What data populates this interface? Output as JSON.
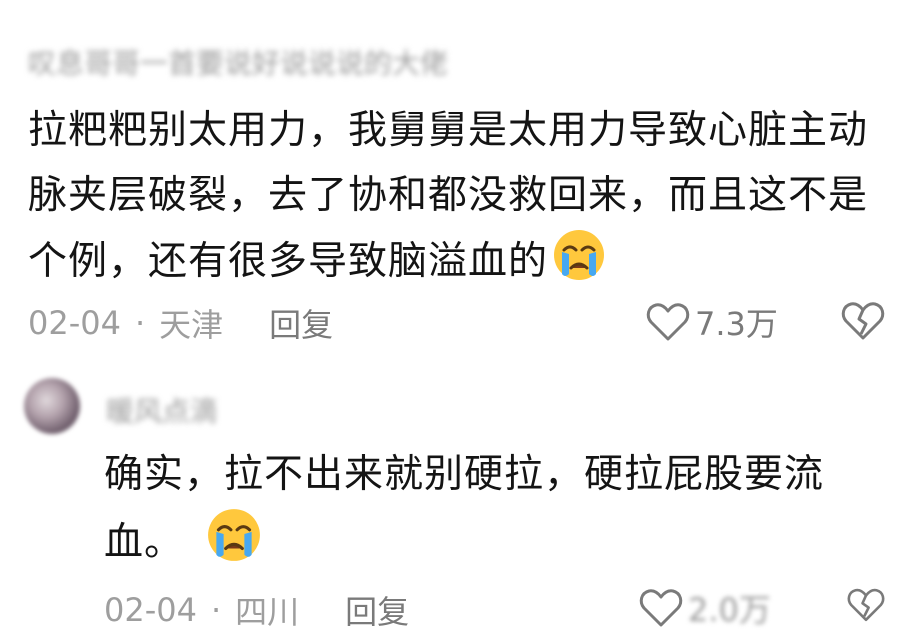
{
  "comment1": {
    "author": "叹息哥哥一首要说好说说说的大佬",
    "lines": [
      "拉粑粑别太用力，我舅舅是太用力导致心脏主动",
      "脉夹层破裂，去了协和都没救回来，而且这不是",
      "个例，还有很多导致脑溢血的"
    ],
    "date": "02-04",
    "separator": "·",
    "location": "天津",
    "reply_label": "回复",
    "likes": "7.3万"
  },
  "comment2": {
    "author": "暖风点滴",
    "lines": [
      "确实，拉不出来就别硬拉，硬拉屁股要流",
      "血。"
    ],
    "date": "02-04",
    "separator": "·",
    "location": "四川",
    "reply_label": "回复",
    "likes": "2.0万"
  },
  "icons": {
    "heart": "heart-outline-icon",
    "broken_heart": "broken-heart-icon",
    "emoji": "crying-face-emoji"
  },
  "colors": {
    "text": "#141414",
    "meta": "#9e9e9e",
    "emoji_face": "#ffc83d",
    "emoji_tear": "#47a8f0"
  }
}
